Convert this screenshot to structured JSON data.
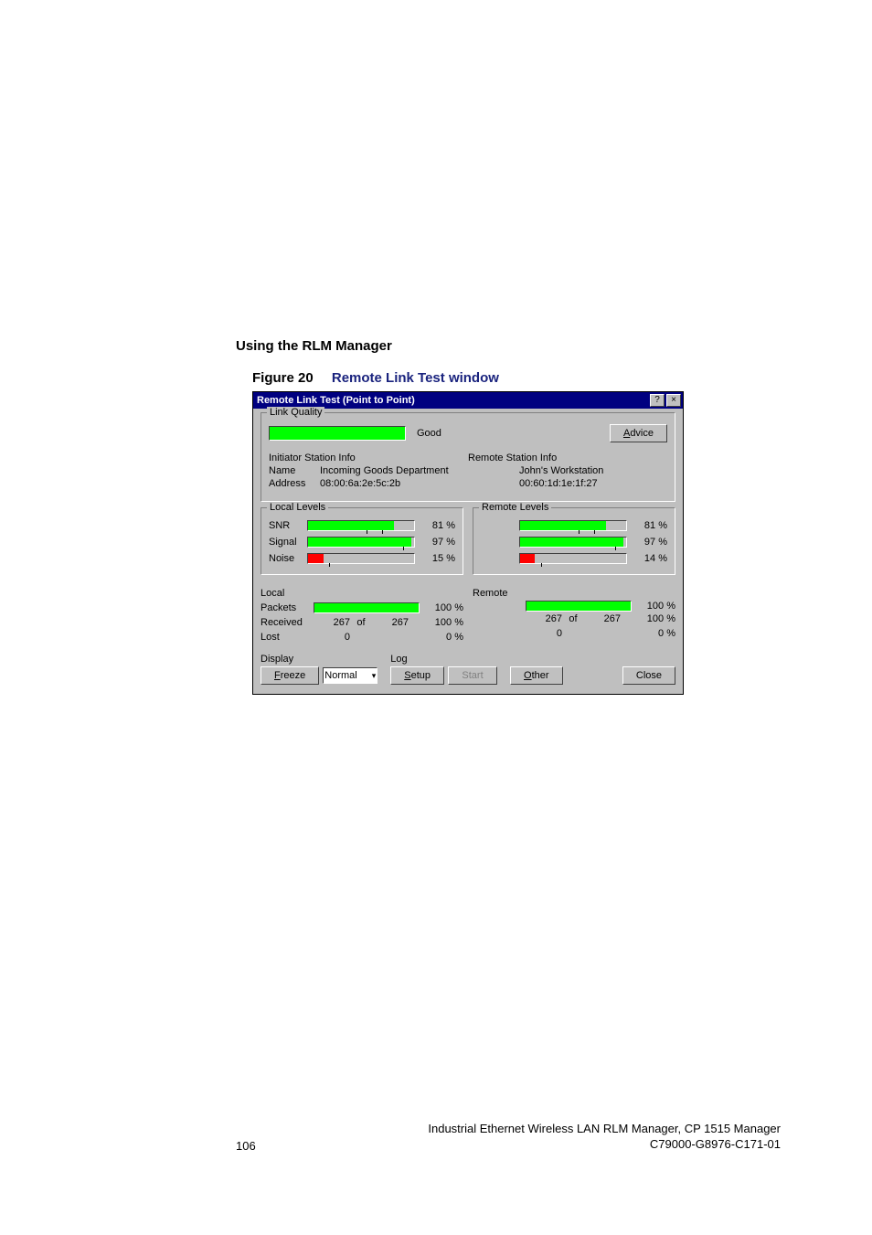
{
  "heading": "Using the RLM Manager",
  "figure_label": "Figure 20",
  "figure_caption": "Remote Link Test window",
  "dialog": {
    "title": "Remote Link Test (Point to Point)",
    "help_btn": "?",
    "close_btn": "×",
    "link_quality": {
      "legend": "Link Quality",
      "status": "Good",
      "advice_btn": "Advice"
    },
    "initiator": {
      "heading": "Initiator Station Info",
      "name_label": "Name",
      "name_value": "Incoming Goods Department",
      "addr_label": "Address",
      "addr_value": "08:00:6a:2e:5c:2b"
    },
    "remote": {
      "heading": "Remote Station Info",
      "name_value": "John's Workstation",
      "addr_value": "00:60:1d:1e:1f:27"
    },
    "local_levels": {
      "legend": "Local Levels",
      "snr": {
        "label": "SNR",
        "pct": "81 %",
        "fill": 81,
        "color": "#00ff00"
      },
      "signal": {
        "label": "Signal",
        "pct": "97 %",
        "fill": 97,
        "color": "#00ff00"
      },
      "noise": {
        "label": "Noise",
        "pct": "15 %",
        "fill": 15,
        "color": "#ff0000"
      }
    },
    "remote_levels": {
      "legend": "Remote Levels",
      "snr": {
        "pct": "81 %",
        "fill": 81,
        "color": "#00ff00"
      },
      "signal": {
        "pct": "97 %",
        "fill": 97,
        "color": "#00ff00"
      },
      "noise": {
        "pct": "14 %",
        "fill": 14,
        "color": "#ff0000"
      }
    },
    "packets": {
      "local_label": "Local",
      "remote_label": "Remote",
      "packets_label": "Packets",
      "received_label": "Received",
      "lost_label": "Lost",
      "of_label": "of",
      "local": {
        "bar_pct": "100 %",
        "recv": "267",
        "total": "267",
        "recv_pct": "100 %",
        "lost": "0",
        "lost_pct": "0 %"
      },
      "remote": {
        "bar_pct": "100 %",
        "recv": "267",
        "total": "267",
        "recv_pct": "100 %",
        "lost": "0",
        "lost_pct": "0 %"
      }
    },
    "bottom": {
      "display_label": "Display",
      "freeze_btn": "Freeze",
      "normal_sel": "Normal",
      "log_label": "Log",
      "setup_btn": "Setup",
      "start_btn": "Start",
      "other_btn": "Other",
      "close_btn": "Close"
    }
  },
  "footer": {
    "page": "106",
    "line1": "Industrial Ethernet Wireless LAN  RLM Manager,  CP 1515 Manager",
    "line2": "C79000-G8976-C171-01"
  }
}
